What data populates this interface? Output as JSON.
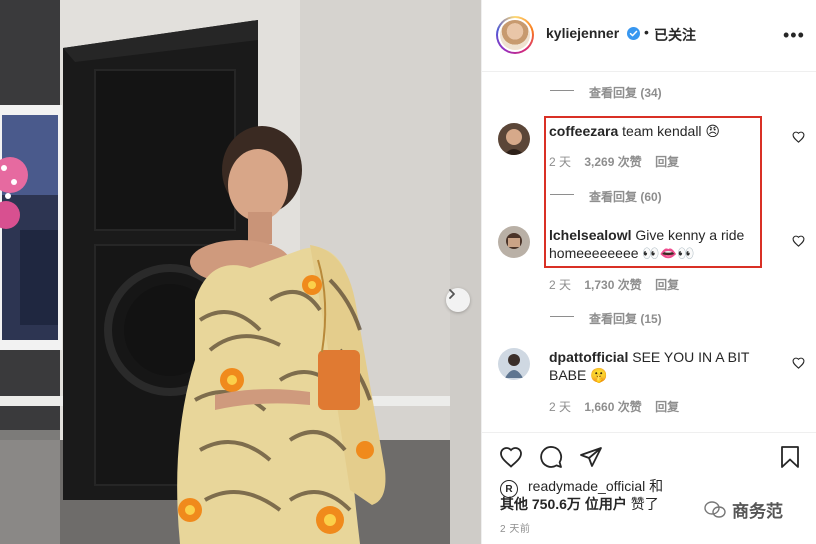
{
  "post": {
    "username": "kylie­jenner",
    "follow_state": "已关注",
    "dot_separator": "•",
    "more_menu_icon": "more-dots-icon",
    "photo_description_icon": "post-photo"
  },
  "comments": {
    "view_replies_1": "查看回复 (34)",
    "items": [
      {
        "username": "coffeezara",
        "text": "team kendall 😠",
        "time": "2 天",
        "likes": "3,269 次赞",
        "reply": "回复",
        "view_replies": "查看回复 (60)"
      },
      {
        "username": "lchelsealowl",
        "text": "Give kenny a ride homeeeeeeee 👀👄👀",
        "time": "2 天",
        "likes": "1,730 次赞",
        "reply": "回复",
        "view_replies": "查看回复 (15)"
      },
      {
        "username": "dpattofficial",
        "text": "SEE YOU IN A BIT BABE 🤫",
        "time": "2 天",
        "likes": "1,660 次赞",
        "reply": "回复"
      }
    ]
  },
  "likes_section": {
    "liked_by_user": "readymade_official",
    "and": "和",
    "others_line": "其他 750.6万 位用户",
    "liked_word": "赞了",
    "posted": "2 天前"
  },
  "watermark": {
    "text": "商务范"
  },
  "colors": {
    "highlight_border": "#d93025",
    "muted_text": "#8e8e8e",
    "verified_blue": "#3897f0"
  }
}
